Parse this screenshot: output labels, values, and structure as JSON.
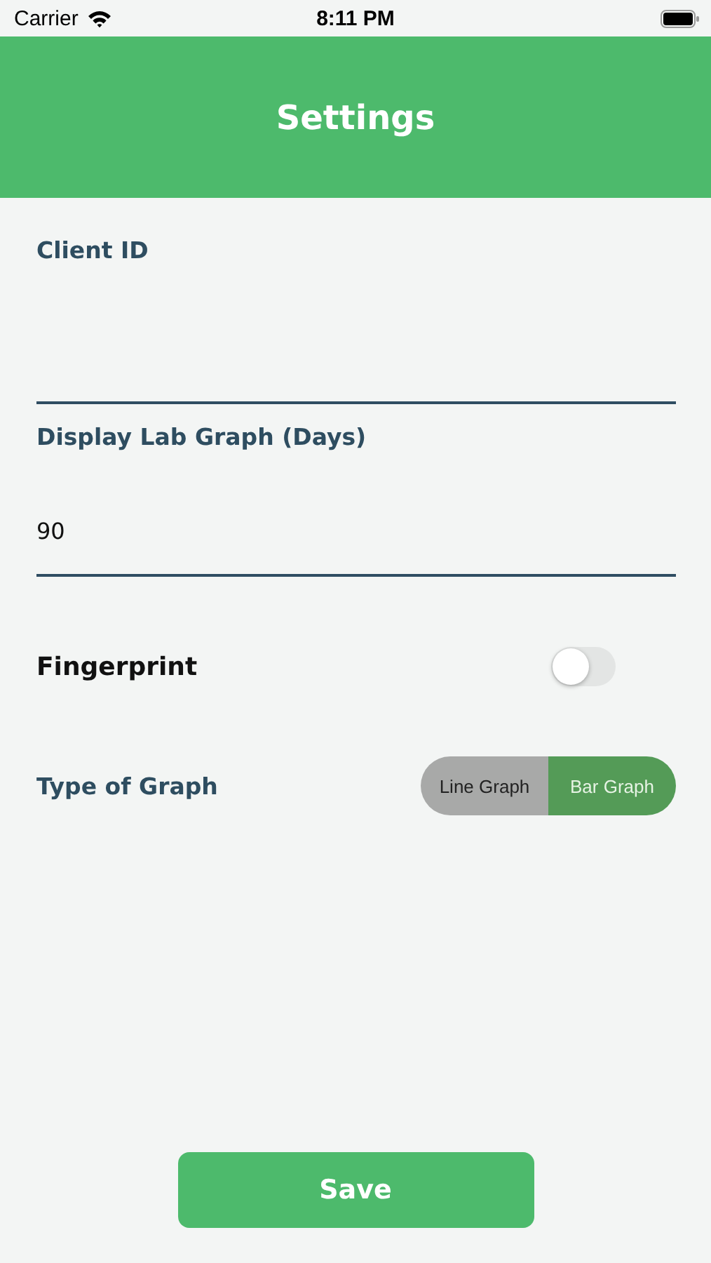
{
  "status_bar": {
    "carrier": "Carrier",
    "time": "8:11 PM"
  },
  "header": {
    "title": "Settings"
  },
  "fields": [
    {
      "label": "Client ID"
    },
    {
      "label": "Display Lab Graph (Days)",
      "value": "90"
    }
  ],
  "fingerprint": {
    "label": "Fingerprint",
    "on": false
  },
  "graph_type": {
    "label": "Type of Graph",
    "options": [
      {
        "label": "Line Graph",
        "selected": false
      },
      {
        "label": "Bar Graph",
        "selected": true
      }
    ]
  },
  "save_button": "Save"
}
